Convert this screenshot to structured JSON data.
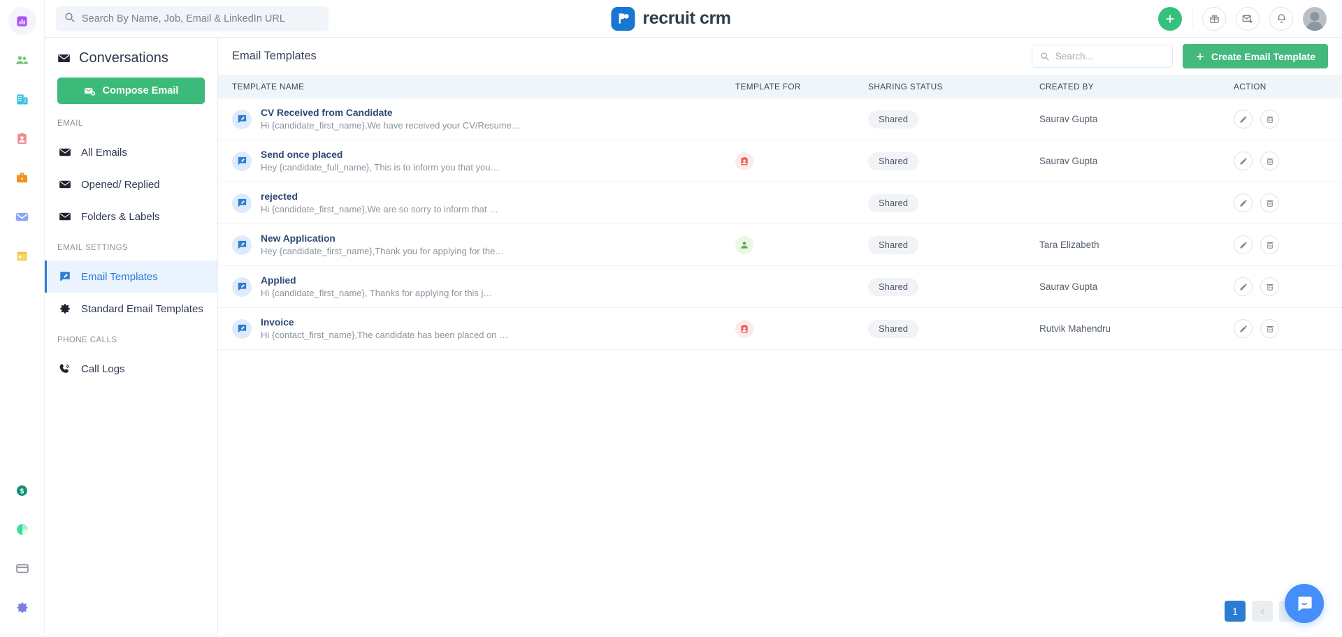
{
  "topbar": {
    "search": {
      "placeholder": "Search By Name, Job, Email & LinkedIn URL",
      "value": "",
      "icon": "search-icon"
    },
    "brand": {
      "text": "recruit crm",
      "logo_icon": "recruit-crm-logo-icon",
      "logo_color": "#1877d2"
    },
    "actions": [
      {
        "name": "add-button",
        "icon": "plus-icon",
        "color": "#35c07b"
      },
      {
        "name": "referral-button",
        "icon": "gift-icon"
      },
      {
        "name": "mail-button",
        "icon": "mail-plus-icon"
      },
      {
        "name": "notifications-button",
        "icon": "bell-icon"
      },
      {
        "name": "profile-avatar",
        "icon": "avatar-icon"
      }
    ]
  },
  "rail": {
    "items": [
      {
        "label": "Dashboard",
        "icon": "bar-chart-icon",
        "color": "#a855f7",
        "active": true
      },
      {
        "label": "Contacts",
        "icon": "people-icon",
        "color": "#7cc576"
      },
      {
        "label": "Companies",
        "icon": "building-icon",
        "color": "#35c4dd"
      },
      {
        "label": "Candidates",
        "icon": "id-card-icon",
        "color": "#f08c8c"
      },
      {
        "label": "Jobs",
        "icon": "briefcase-icon",
        "color": "#f0921e"
      },
      {
        "label": "Email",
        "icon": "envelope-icon",
        "color": "#8aa7f5"
      },
      {
        "label": "Calendar",
        "icon": "calendar-icon",
        "color": "#f7d567"
      }
    ],
    "bottom_items": [
      {
        "label": "Deals",
        "icon": "dollar-circle-icon",
        "color": "#148f77"
      },
      {
        "label": "Reports",
        "icon": "pie-chart-icon",
        "color": "#3ddc97"
      },
      {
        "label": "Billing",
        "icon": "credit-card-icon",
        "color": "#8c929b"
      },
      {
        "label": "Settings",
        "icon": "gear-icon",
        "color": "#7b7fe0"
      }
    ]
  },
  "sidebar": {
    "title": "Conversations",
    "title_icon": "envelope-icon",
    "compose_label": "Compose Email",
    "compose_icon": "mail-plus-icon",
    "groups": [
      {
        "label": "EMAIL",
        "items": [
          {
            "label": "All Emails",
            "icon": "envelope-icon",
            "active": false
          },
          {
            "label": "Opened/ Replied",
            "icon": "envelope-icon",
            "active": false
          },
          {
            "label": "Folders & Labels",
            "icon": "envelope-icon",
            "active": false
          }
        ]
      },
      {
        "label": "EMAIL SETTINGS",
        "items": [
          {
            "label": "Email Templates",
            "icon": "template-edit-icon",
            "active": true
          },
          {
            "label": "Standard Email Templates",
            "icon": "gear-icon",
            "active": false
          }
        ]
      },
      {
        "label": "PHONE CALLS",
        "items": [
          {
            "label": "Call Logs",
            "icon": "phone-icon",
            "active": false
          }
        ]
      }
    ]
  },
  "main": {
    "title": "Email Templates",
    "search": {
      "placeholder": "Search...",
      "value": "",
      "icon": "search-icon"
    },
    "create_button": {
      "label": "Create Email Template",
      "icon": "plus-icon"
    },
    "columns": [
      "TEMPLATE NAME",
      "TEMPLATE FOR",
      "SHARING STATUS",
      "CREATED BY",
      "ACTION"
    ],
    "rows": [
      {
        "name": "CV Received from Candidate",
        "preview": "Hi {candidate_first_name},We have received your CV/Resume…",
        "template_for": "",
        "sharing_status": "Shared",
        "created_by": "Saurav Gupta"
      },
      {
        "name": "Send once placed",
        "preview": "Hey {candidate_full_name}, This is to inform you that you…",
        "template_for": "contact",
        "sharing_status": "Shared",
        "created_by": "Saurav Gupta"
      },
      {
        "name": "rejected",
        "preview": "Hi {candidate_first_name},We are so sorry to inform that …",
        "template_for": "",
        "sharing_status": "Shared",
        "created_by": ""
      },
      {
        "name": "New Application",
        "preview": "Hey {candidate_first_name},Thank you for applying for the…",
        "template_for": "candidate",
        "sharing_status": "Shared",
        "created_by": "Tara Elizabeth"
      },
      {
        "name": "Applied",
        "preview": "Hi {candidate_first_name}, Thanks for applying for this j…",
        "template_for": "",
        "sharing_status": "Shared",
        "created_by": "Saurav Gupta"
      },
      {
        "name": "Invoice",
        "preview": "Hi {contact_first_name},The candidate has been placed on …",
        "template_for": "contact",
        "sharing_status": "Shared",
        "created_by": "Rutvik Mahendru"
      }
    ],
    "row_action_icons": {
      "edit": "pencil-icon",
      "delete": "trash-icon"
    },
    "pagination": {
      "current": "1",
      "prev_icon": "chevron-left-icon",
      "next_icon": "chevron-right-icon"
    }
  },
  "chat_widget": {
    "icon": "chat-bubble-icon",
    "color": "#468ef9"
  }
}
